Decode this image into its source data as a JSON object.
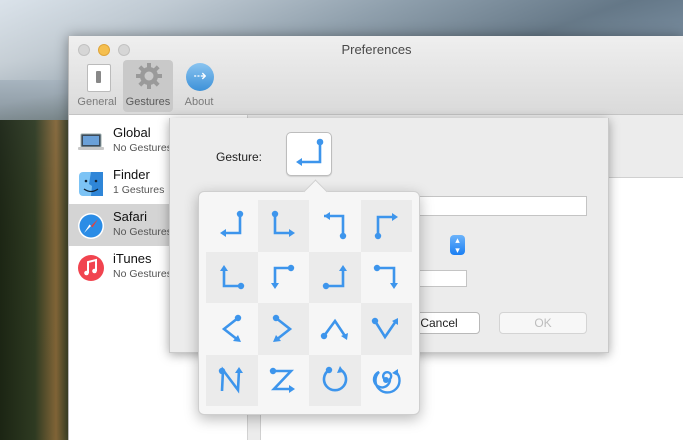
{
  "window": {
    "title": "Preferences"
  },
  "toolbar": {
    "items": [
      {
        "label": "General",
        "icon": "general-switch-icon"
      },
      {
        "label": "Gestures",
        "icon": "gear-icon",
        "selected": true
      },
      {
        "label": "About",
        "icon": "about-arrow-icon"
      }
    ]
  },
  "apps": [
    {
      "name": "Global",
      "status": "No Gestures",
      "icon": "laptop-icon"
    },
    {
      "name": "Finder",
      "status": "1 Gestures",
      "icon": "finder-icon"
    },
    {
      "name": "Safari",
      "status": "No Gestures",
      "icon": "safari-compass-icon",
      "selected": true
    },
    {
      "name": "iTunes",
      "status": "No Gestures",
      "icon": "itunes-music-icon"
    }
  ],
  "sheet": {
    "gesture_label": "Gesture:",
    "cancel_label": "Cancel",
    "ok_label": "OK"
  },
  "gesture_picker": {
    "selected_index": 0,
    "gestures": [
      "up-then-left",
      "down-then-right",
      "left-then-down",
      "up-then-right",
      "left-then-up",
      "right-then-down",
      "down-then-left",
      "right-then-down-hook",
      "left-bracket",
      "right-bracket",
      "caret-up",
      "check-down",
      "n-shape",
      "z-shape",
      "circle-counterclockwise",
      "spiral-clockwise"
    ]
  },
  "colors": {
    "accent": "#3d95ec",
    "selection": "#d4d4d4"
  }
}
